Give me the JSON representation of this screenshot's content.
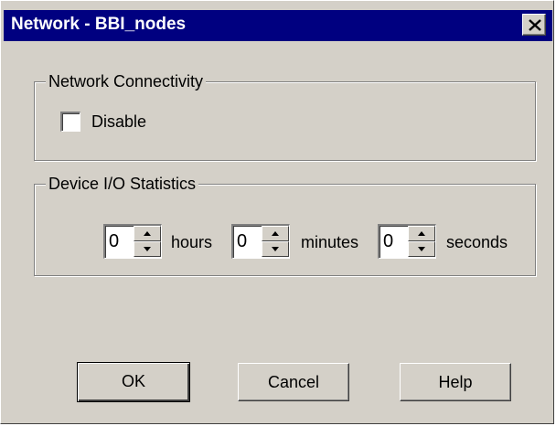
{
  "window": {
    "title": "Network - BBI_nodes",
    "close_symbol": "close-icon"
  },
  "connectivity": {
    "legend": "Network Connectivity",
    "disable_label": "Disable",
    "disable_checked": false
  },
  "statistics": {
    "legend": "Device I/O Statistics",
    "hours": {
      "value": "0",
      "unit": "hours"
    },
    "minutes": {
      "value": "0",
      "unit": "minutes"
    },
    "seconds": {
      "value": "0",
      "unit": "seconds"
    }
  },
  "buttons": {
    "ok": "OK",
    "cancel": "Cancel",
    "help": "Help"
  },
  "colors": {
    "titlebar": "#000080",
    "face": "#d4d0c8"
  }
}
